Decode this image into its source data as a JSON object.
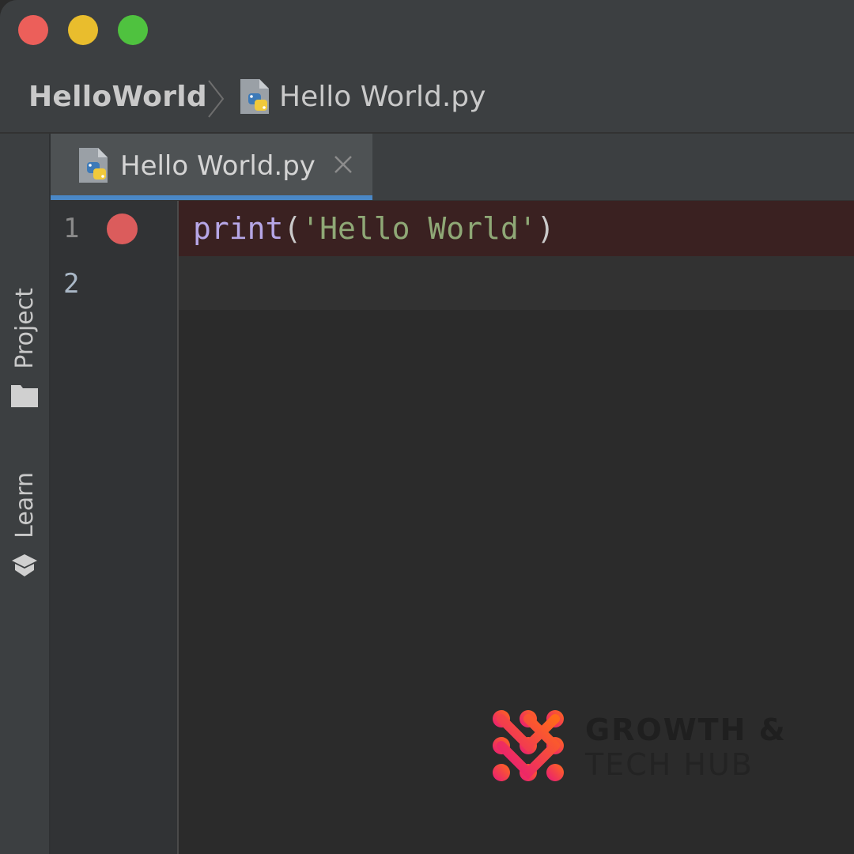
{
  "window": {
    "traffic_lights": [
      {
        "name": "close",
        "color": "#ec5f5a"
      },
      {
        "name": "minimize",
        "color": "#e9bd2d"
      },
      {
        "name": "maximize",
        "color": "#4fc23f"
      }
    ]
  },
  "breadcrumb": {
    "project": "HelloWorld",
    "file": "Hello World.py",
    "file_icon": "python-file-icon"
  },
  "toolstrip": {
    "project_label": "Project",
    "project_icon": "folder-icon",
    "learn_label": "Learn",
    "learn_icon": "graduation-cap-icon"
  },
  "tabs": [
    {
      "label": "Hello World.py",
      "icon": "python-file-icon",
      "active": true,
      "close_icon": "close-icon"
    }
  ],
  "editor": {
    "line_numbers": [
      "1",
      "2"
    ],
    "breakpoint_line": 1,
    "code": {
      "fn": "print",
      "open": "(",
      "str": "'Hello World'",
      "close": ")"
    }
  },
  "watermark": {
    "line1": "GROWTH &",
    "line2": "TECH HUB"
  },
  "colors": {
    "accent_tab": "#4a88c7",
    "breakpoint": "#db5c5c",
    "string": "#8fa876",
    "builtin": "#b6a6e6"
  }
}
